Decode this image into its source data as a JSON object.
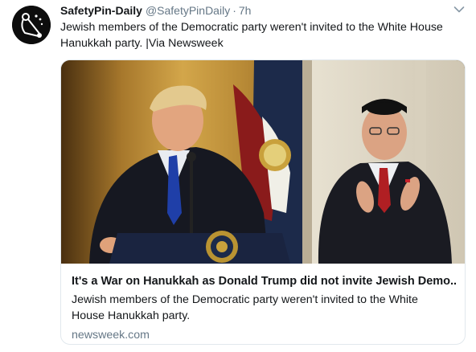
{
  "tweet": {
    "display_name": "SafetyPin-Daily",
    "handle": "@SafetyPinDaily",
    "separator": "·",
    "time": "7h",
    "text_line1": "Jewish members of the Democratic party weren't invited to the White House",
    "text_line2": "Hanukkah party.  |Via Newsweek"
  },
  "card": {
    "title": "It's a War on Hanukkah as Donald Trump did not invite Jewish Demo...",
    "description_line1": "Jewish members of the Democratic party weren't invited to the White",
    "description_line2": "House Hanukkah party.",
    "domain": "newsweek.com"
  },
  "icons": {
    "avatar": "safety-pin-logo",
    "caret": "chevron-down-icon"
  },
  "colors": {
    "text": "#14171a",
    "secondary": "#657786",
    "border": "#e1e8ed"
  }
}
